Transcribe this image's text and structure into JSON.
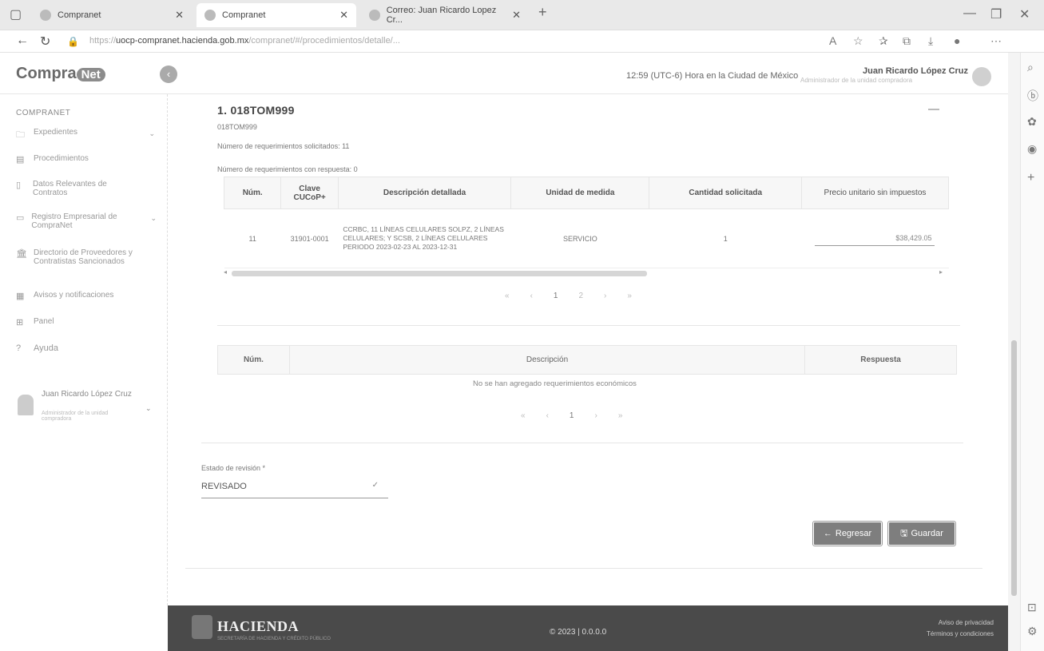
{
  "browser": {
    "tabs": [
      {
        "label": "Compranet",
        "active": false
      },
      {
        "label": "Compranet",
        "active": true
      },
      {
        "label": "Correo: Juan Ricardo Lopez Cr...",
        "active": false
      }
    ],
    "new_tab": "+",
    "url_prefix": "https://",
    "url_host": "uocp-compranet.hacienda.gob.mx",
    "url_path": "/compranet/#/procedimientos/detalle/..."
  },
  "header": {
    "logo_text": "Compra",
    "logo_badge": "Net",
    "collapse_icon": "chevron-left",
    "clock": "12:59 (UTC-6) Hora en la Ciudad de México",
    "user_name": "Juan Ricardo López Cruz",
    "user_role": "Administrador de la unidad compradora"
  },
  "sidebar": {
    "section": "COMPRANET",
    "items": [
      {
        "label": "Expedientes",
        "icon": "folder-icon",
        "has_chevron": true
      },
      {
        "label": "Procedimientos",
        "icon": "document-icon",
        "has_chevron": false
      },
      {
        "label": "Datos Relevantes de Contratos",
        "icon": "bookmark-icon",
        "has_chevron": false
      },
      {
        "label": "Registro Empresarial de CompraNet",
        "icon": "id-card-icon",
        "has_chevron": true
      },
      {
        "label": "Directorio de Proveedores y Contratistas Sancionados",
        "icon": "building-icon",
        "has_chevron": false
      },
      {
        "label": "Avisos y notificaciones",
        "icon": "calendar-icon",
        "has_chevron": false
      },
      {
        "label": "Panel",
        "icon": "grid-icon",
        "has_chevron": false
      },
      {
        "label": "Ayuda",
        "icon": "question-icon",
        "has_chevron": false
      }
    ],
    "user_name": "Juan Ricardo López Cruz",
    "user_role": "Administrador de la unidad compradora"
  },
  "section": {
    "title": "1. 018TOM999",
    "code": "018TOM999",
    "requested_count_label": "Número de requerimientos solicitados: 11",
    "answered_count_label": "Número de requerimientos con respuesta: 0"
  },
  "requirements_table": {
    "headers": [
      "Núm.",
      "Clave CUCoP+",
      "Descripción detallada",
      "Unidad de medida",
      "Cantidad solicitada",
      "Precio unitario sin impuestos"
    ],
    "rows": [
      {
        "num": "11",
        "clave": "31901-0001",
        "descripcion": "CCRBC, 11 LÍNEAS CELULARES SOLPZ, 2 LÍNEAS CELULARES; Y SCSB, 2 LÍNEAS CELULARES PERIODO 2023-02-23 AL 2023-12-31",
        "unidad": "SERVICIO",
        "cantidad": "1",
        "precio": "$38,429.05"
      }
    ]
  },
  "pager1": {
    "first": "«",
    "prev": "‹",
    "pages": [
      "1",
      "2"
    ],
    "current": "1",
    "next": "›",
    "last": "»"
  },
  "economic_table": {
    "headers": [
      "Núm.",
      "Descripción",
      "Respuesta"
    ],
    "empty_message": "No se han agregado requerimientos económicos"
  },
  "pager2": {
    "first": "«",
    "prev": "‹",
    "pages": [
      "1"
    ],
    "current": "1",
    "next": "›",
    "last": "»"
  },
  "review": {
    "label": "Estado de revisión *",
    "value": "REVISADO"
  },
  "actions": {
    "back_label": "Regresar",
    "save_label": "Guardar"
  },
  "footer": {
    "brand": "HACIENDA",
    "brand_sub": "SECRETARÍA DE HACIENDA Y CRÉDITO PÚBLICO",
    "copyright": "© 2023 | 0.0.0.0",
    "privacy": "Aviso de privacidad",
    "terms": "Términos y condiciones"
  },
  "colors": {
    "button_bg": "#7e7e7e",
    "footer_bg": "#4a4a4a",
    "header_bg": "#f7f7f7"
  }
}
